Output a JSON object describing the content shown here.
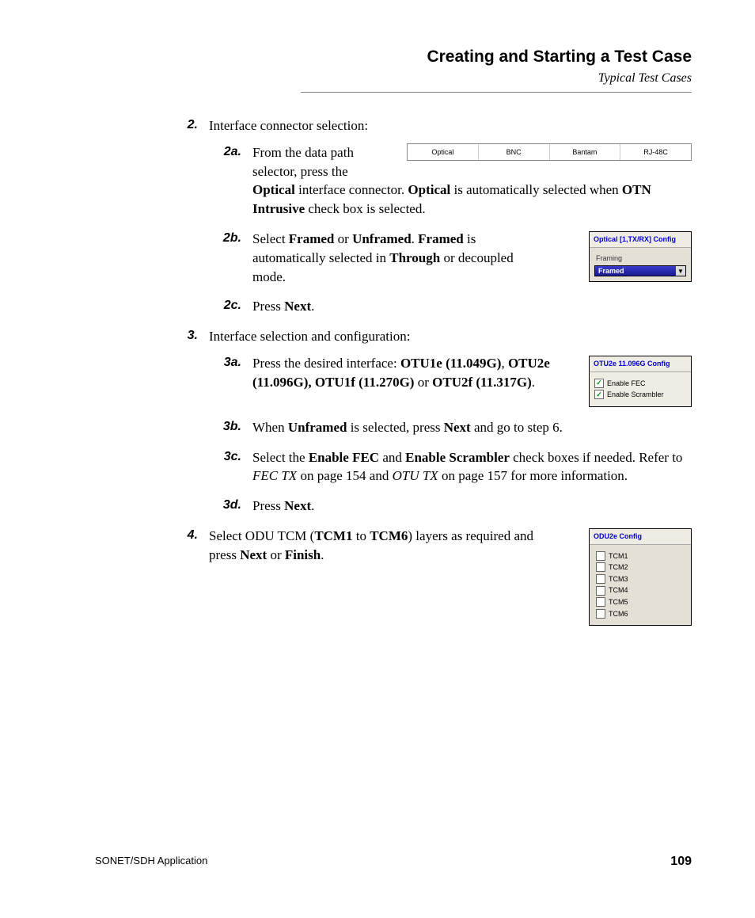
{
  "header": {
    "title": "Creating and Starting a Test Case",
    "subtitle": "Typical Test Cases"
  },
  "steps": {
    "s2": {
      "num": "2.",
      "title": "Interface connector selection:",
      "a": {
        "num": "2a.",
        "line1_pre": "From the data path selector, press the ",
        "optical_bold": "Optical",
        "line1_mid": " interface connector. ",
        "optical_bold2": "Optical",
        "line1_mid2": " is automatically selected when ",
        "otn_bold": "OTN Intrusive",
        "line1_post": " check box is selected."
      },
      "b": {
        "num": "2b.",
        "pre": "Select ",
        "framed": "Framed",
        "or": " or ",
        "unframed": "Unframed",
        "dot": ". ",
        "framed2": "Framed",
        "mid": " is automatically selected in ",
        "through": "Through",
        "post": " or decoupled mode."
      },
      "c": {
        "num": "2c.",
        "pre": "Press ",
        "next": "Next",
        "dot": "."
      }
    },
    "s3": {
      "num": "3.",
      "title": "Interface selection and configuration:",
      "a": {
        "num": "3a.",
        "pre": "Press the desired interface: ",
        "otu1e": "OTU1e (11.049G)",
        "comma": ", ",
        "otu2e": "OTU2e (11.096G), OTU1f (11.270G)",
        "or": " or ",
        "otu2f": "OTU2f (11.317G)",
        "dot": "."
      },
      "b": {
        "num": "3b.",
        "pre": "When ",
        "unframed": "Unframed",
        "mid": " is selected, press ",
        "next": "Next",
        "post": " and go to step 6."
      },
      "c": {
        "num": "3c.",
        "pre": "Select the ",
        "fec": "Enable FEC",
        "and": " and ",
        "scr": "Enable Scrambler",
        "mid": " check boxes if needed. Refer to ",
        "ref1": "FEC TX",
        "pg1": " on page 154 and ",
        "ref2": "OTU TX",
        "pg2": " on page 157 for more information."
      },
      "d": {
        "num": "3d.",
        "pre": "Press ",
        "next": "Next",
        "dot": "."
      }
    },
    "s4": {
      "num": "4.",
      "pre": "Select ODU TCM (",
      "tcm1": "TCM1",
      "to": " to ",
      "tcm6": "TCM6",
      "mid": ") layers as required and press ",
      "next": "Next",
      "or": " or ",
      "finish": "Finish",
      "dot": "."
    }
  },
  "figs": {
    "connectors": [
      "Optical",
      "BNC",
      "Bantam",
      "RJ-48C"
    ],
    "optical_panel": {
      "title": "Optical [1,TX/RX] Config",
      "framing_label": "Framing",
      "value": "Framed"
    },
    "otu_panel": {
      "title": "OTU2e 11.096G Config",
      "fec": "Enable FEC",
      "scrambler": "Enable Scrambler"
    },
    "odu_panel": {
      "title": "ODU2e Config",
      "items": [
        "TCM1",
        "TCM2",
        "TCM3",
        "TCM4",
        "TCM5",
        "TCM6"
      ]
    }
  },
  "footer": {
    "left": "SONET/SDH Application",
    "page": "109"
  }
}
